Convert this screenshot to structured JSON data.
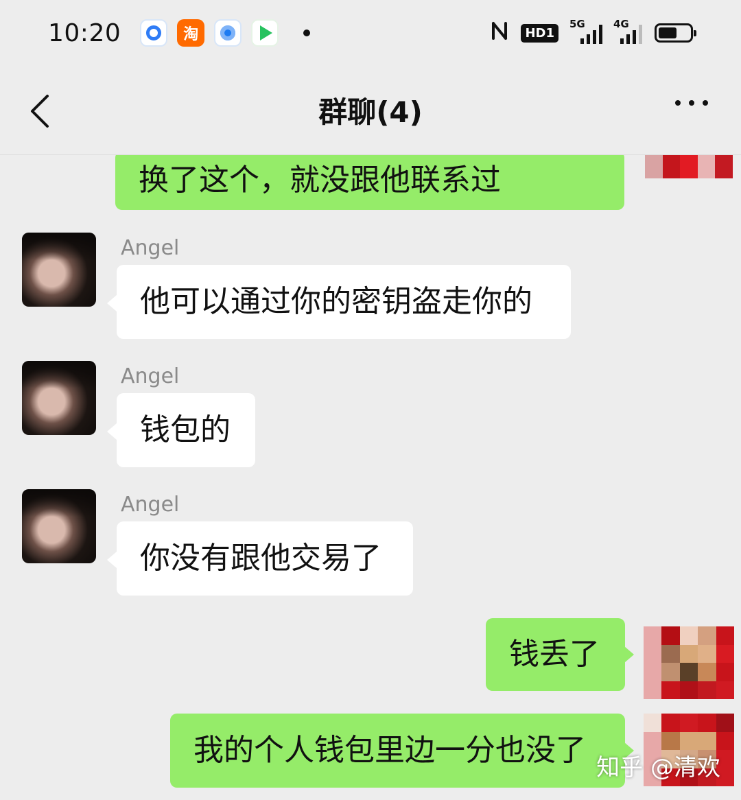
{
  "status_bar": {
    "time": "10:20",
    "app_icons": [
      "browser-icon",
      "taobao-icon",
      "circle-app-icon",
      "video-app-icon"
    ],
    "taobao_glyph": "淘",
    "hd_label": "HD1",
    "signal_1_label": "5G",
    "signal_2_label": "4G"
  },
  "nav": {
    "title": "群聊(4)"
  },
  "messages": [
    {
      "direction": "out",
      "text": "换了这个，就没跟他联系过"
    },
    {
      "direction": "in",
      "sender": "Angel",
      "text": "他可以通过你的密钥盗走你的"
    },
    {
      "direction": "in",
      "sender": "Angel",
      "text": "钱包的"
    },
    {
      "direction": "in",
      "sender": "Angel",
      "text": "你没有跟他交易了"
    },
    {
      "direction": "out",
      "text": "钱丢了"
    },
    {
      "direction": "out",
      "text": "我的个人钱包里边一分也没了"
    }
  ],
  "watermark": "知乎 @清欢",
  "colors": {
    "background": "#ededed",
    "outgoing_bubble": "#95ec69",
    "incoming_bubble": "#ffffff",
    "sender_name": "#8a8a8a"
  }
}
